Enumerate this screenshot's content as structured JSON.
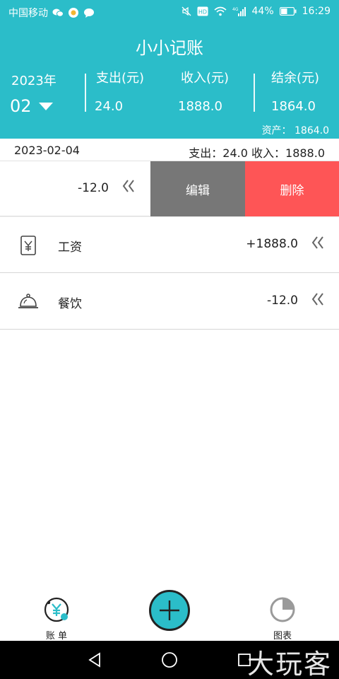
{
  "status_bar": {
    "carrier": "中国移动",
    "battery": "44%",
    "time": "16:29",
    "icons": [
      "wechat-icon",
      "app-icon",
      "message-icon",
      "mute-icon",
      "hd-icon",
      "wifi-icon",
      "signal-4g-icon",
      "battery-icon"
    ]
  },
  "header": {
    "title": "小小记账",
    "year": "2023年",
    "month": "02",
    "expense_label": "支出(元)",
    "expense_value": "24.0",
    "income_label": "收入(元)",
    "income_value": "1888.0",
    "balance_label": "结余(元)",
    "balance_value": "1864.0",
    "assets": "资产： 1864.0"
  },
  "day_summary": {
    "date": "2023-02-04",
    "totals": "支出：24.0 收入：1888.0"
  },
  "swiped_row": {
    "amount": "-12.0",
    "edit_label": "编辑",
    "delete_label": "删除"
  },
  "records": [
    {
      "icon": "salary-icon",
      "label": "工资",
      "amount": "+1888.0"
    },
    {
      "icon": "dining-icon",
      "label": "餐饮",
      "amount": "-12.0"
    }
  ],
  "tabs": {
    "bills_label": "账 单",
    "charts_label": "图表"
  },
  "watermark": "大玩客",
  "colors": {
    "accent": "#2bbdc9",
    "edit_bg": "#777777",
    "delete_bg": "#fe5556"
  }
}
